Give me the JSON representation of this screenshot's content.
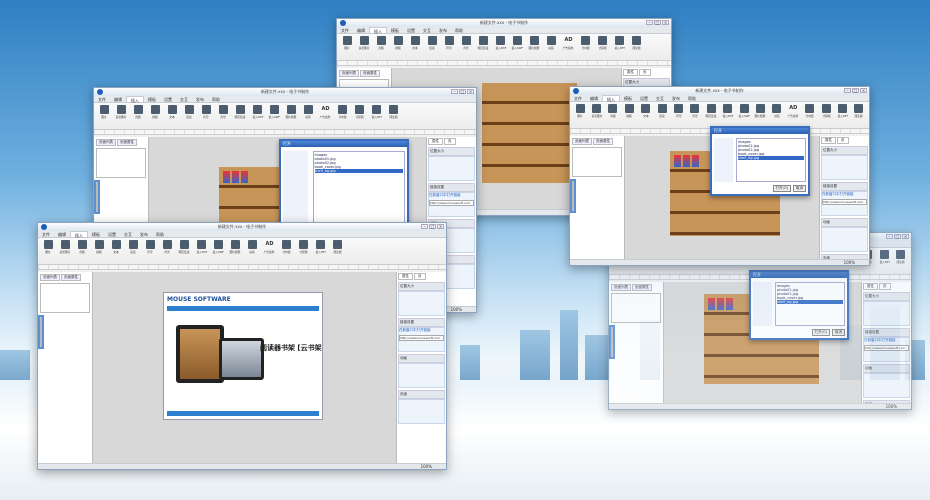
{
  "app": {
    "window_title": "新建文件.xxx - 电子书制作",
    "menu_tabs": [
      "文件",
      "编辑",
      "插入",
      "模板",
      "设置",
      "交互",
      "发布",
      "帮助"
    ],
    "active_tab_index": 2,
    "ribbon_buttons": [
      "图片",
      "多张图片",
      "音频",
      "视频",
      "文本",
      "链接",
      "符号",
      "背景",
      "网页链接",
      "插入PDF",
      "插入SWF",
      "图片相册",
      "动画",
      "广告插件",
      "计时器",
      "计算器",
      "插入PPT",
      "阅读器"
    ],
    "ad_icon_text": "AD",
    "panel_tabs": [
      "页面列表",
      "页面属性"
    ],
    "right_tabs": [
      "属性",
      "页"
    ],
    "right_sections": [
      "位置大小",
      "链接设置",
      "动画",
      "页面"
    ],
    "link_checkbox_label": "在新窗口中打开链接",
    "link_url": "http://www.mousesoft.com",
    "zoom_level": "100%",
    "win_controls": [
      "–",
      "□",
      "×"
    ]
  },
  "front_canvas": {
    "brand": "MOUSE SOFTWARE",
    "headline": "阅读器书架 [云书架"
  },
  "file_dialog": {
    "title": "打开",
    "files": [
      "images",
      "photo01.jpg",
      "photo02.jpg",
      "book_cover.jpg",
      "shelf_bg.jpg"
    ],
    "selected_index": 4,
    "open_label": "打开(O)",
    "cancel_label": "取消"
  }
}
